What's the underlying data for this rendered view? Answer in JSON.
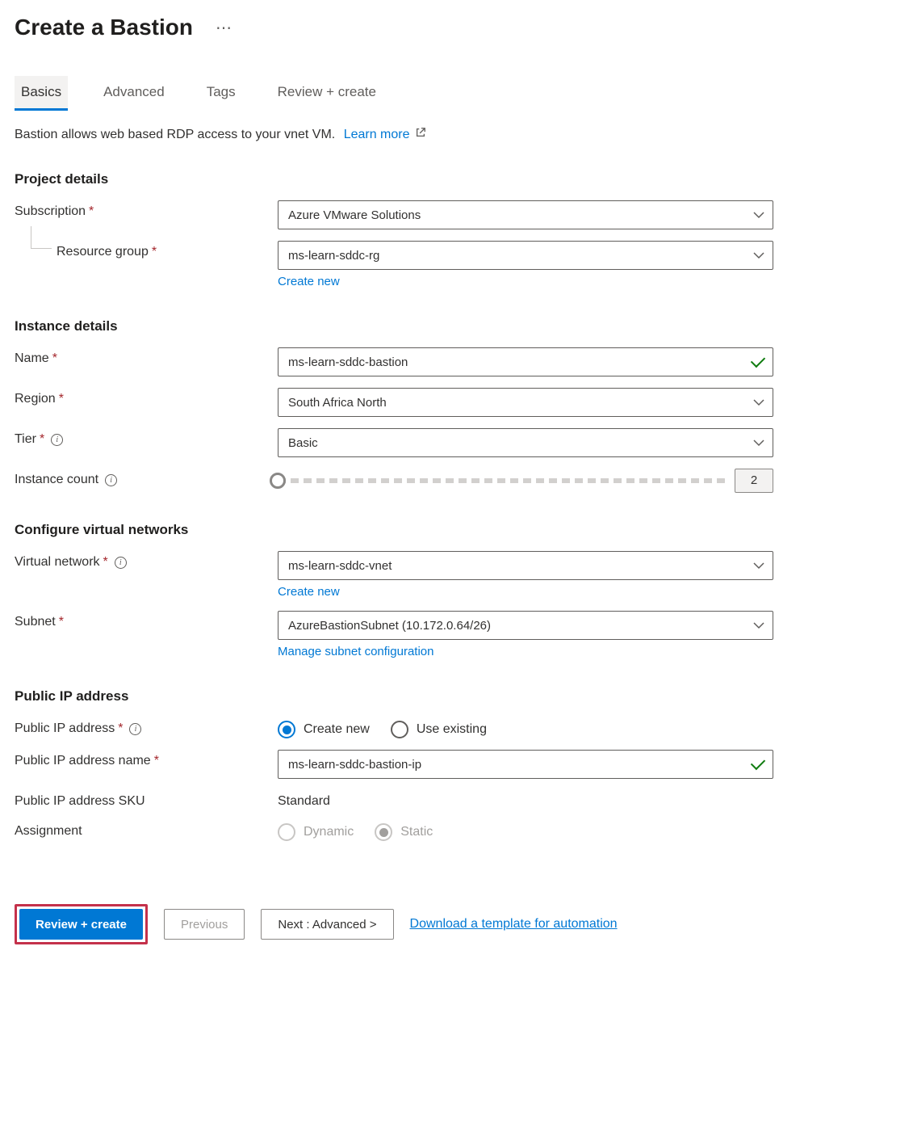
{
  "header": {
    "title": "Create a Bastion"
  },
  "tabs": [
    {
      "label": "Basics",
      "active": true
    },
    {
      "label": "Advanced",
      "active": false
    },
    {
      "label": "Tags",
      "active": false
    },
    {
      "label": "Review + create",
      "active": false
    }
  ],
  "description": {
    "text": "Bastion allows web based RDP access to your vnet VM.",
    "learn_more": "Learn more"
  },
  "project_details": {
    "heading": "Project details",
    "subscription_label": "Subscription",
    "subscription_value": "Azure VMware Solutions",
    "resource_group_label": "Resource group",
    "resource_group_value": "ms-learn-sddc-rg",
    "create_new": "Create new"
  },
  "instance_details": {
    "heading": "Instance details",
    "name_label": "Name",
    "name_value": "ms-learn-sddc-bastion",
    "region_label": "Region",
    "region_value": "South Africa North",
    "tier_label": "Tier",
    "tier_value": "Basic",
    "instance_count_label": "Instance count",
    "instance_count_value": "2"
  },
  "virtual_networks": {
    "heading": "Configure virtual networks",
    "vnet_label": "Virtual network",
    "vnet_value": "ms-learn-sddc-vnet",
    "create_new": "Create new",
    "subnet_label": "Subnet",
    "subnet_value": "AzureBastionSubnet (10.172.0.64/26)",
    "manage_subnet": "Manage subnet configuration"
  },
  "public_ip": {
    "heading": "Public IP address",
    "address_label": "Public IP address",
    "option_create": "Create new",
    "option_existing": "Use existing",
    "name_label": "Public IP address name",
    "name_value": "ms-learn-sddc-bastion-ip",
    "sku_label": "Public IP address SKU",
    "sku_value": "Standard",
    "assignment_label": "Assignment",
    "assignment_dynamic": "Dynamic",
    "assignment_static": "Static"
  },
  "footer": {
    "review_create": "Review + create",
    "previous": "Previous",
    "next": "Next : Advanced >",
    "download_template": "Download a template for automation"
  }
}
